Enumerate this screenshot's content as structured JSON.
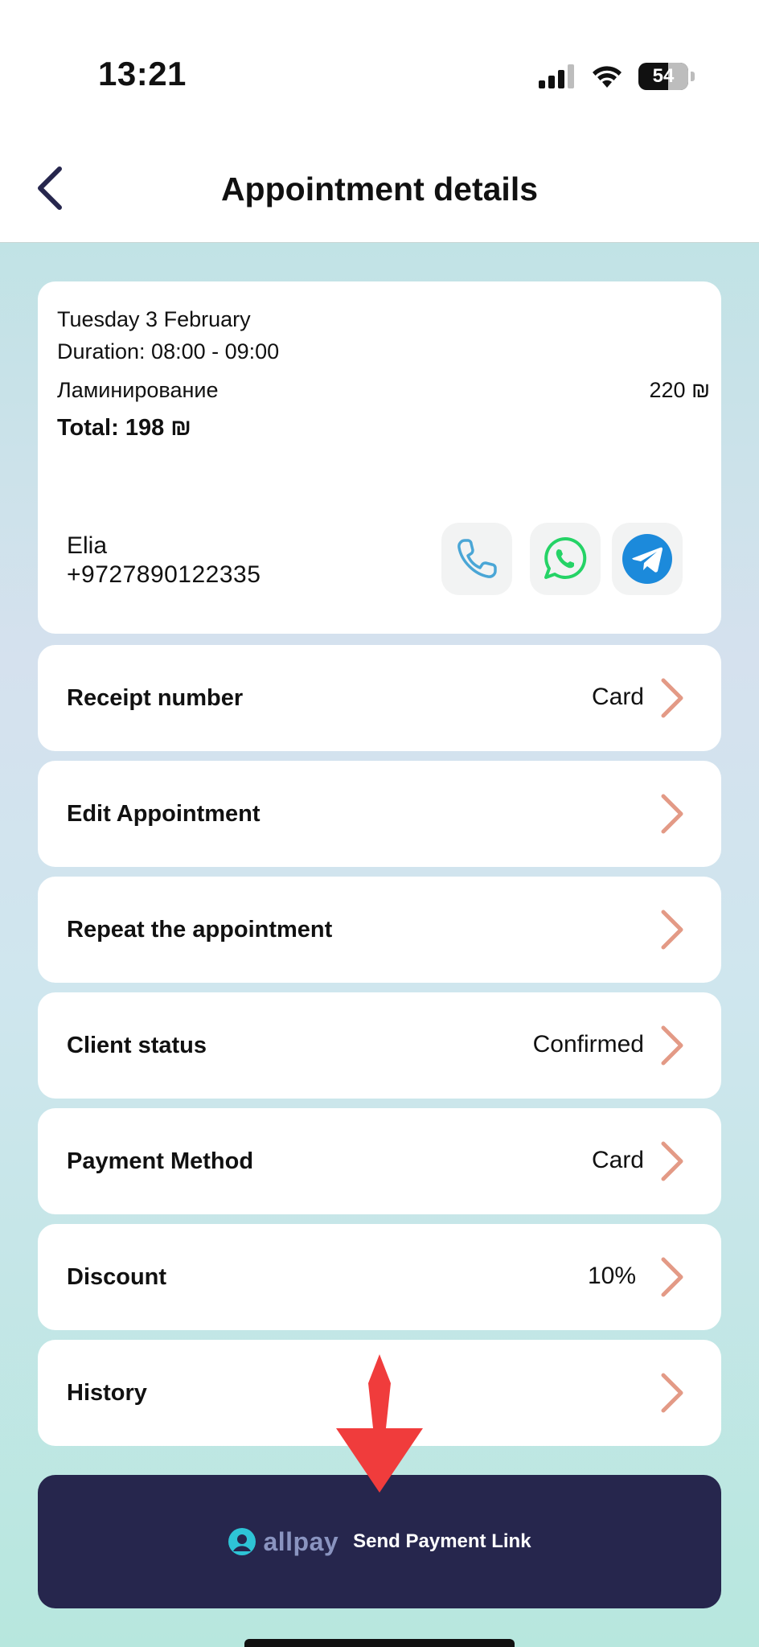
{
  "status_bar": {
    "time": "13:21",
    "battery": "54",
    "icons": [
      "signal-icon",
      "wifi-icon",
      "battery-icon"
    ]
  },
  "header": {
    "title": "Appointment details",
    "back_icon": "chevron-left-icon"
  },
  "appointment": {
    "date": "Tuesday 3 February",
    "duration": "Duration: 08:00 - 09:00",
    "service": "Ламинирование",
    "service_price": "220 ₪",
    "total": "Total: 198 ₪",
    "client_name": "Elia",
    "client_phone": "+9727890122335",
    "contact_buttons": [
      "phone-icon",
      "whatsapp-icon",
      "telegram-icon"
    ]
  },
  "rows": [
    {
      "label": "Receipt number",
      "value": "Card"
    },
    {
      "label": "Edit Appointment",
      "value": ""
    },
    {
      "label": "Repeat the appointment",
      "value": ""
    },
    {
      "label": "Client status",
      "value": "Confirmed"
    },
    {
      "label": "Payment Method",
      "value": "Card"
    },
    {
      "label": "Discount",
      "value": "10%"
    },
    {
      "label": "History",
      "value": ""
    }
  ],
  "payment_button": {
    "brand": "allpay",
    "label": "Send Payment Link"
  },
  "colors": {
    "accent_dark": "#26264d",
    "chevron": "#e39a86",
    "whatsapp": "#25d366",
    "telegram": "#1c8adb",
    "phone": "#4aa6d6",
    "annotation_arrow": "#f03c3c"
  }
}
